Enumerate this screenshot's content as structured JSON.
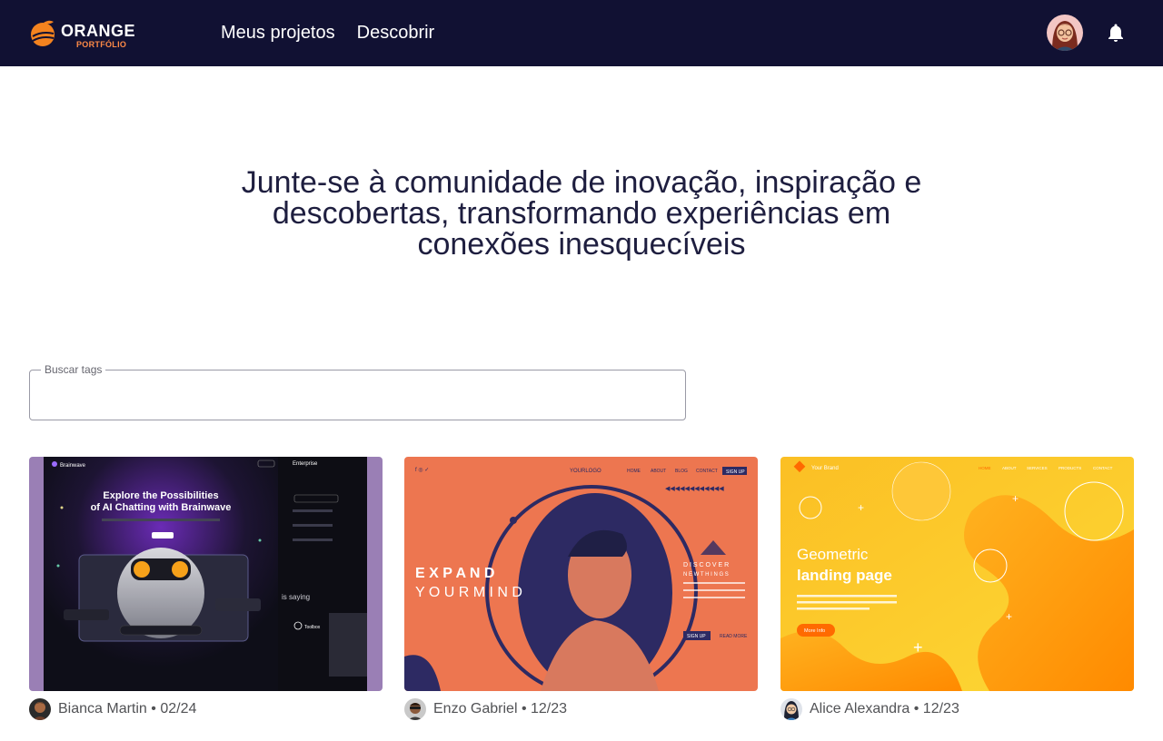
{
  "header": {
    "logo": {
      "brand": "ORANGE",
      "sub": "PORTFÓLIO",
      "icon": "orange-logo-icon"
    },
    "nav": [
      {
        "label": "Meus projetos"
      },
      {
        "label": "Descobrir"
      }
    ],
    "icons": {
      "avatar": "user-avatar",
      "notifications": "bell-icon"
    }
  },
  "hero": {
    "text": "Junte-se à comunidade de inovação, inspiração e descobertas, transformando experiências em conexões inesquecíveis"
  },
  "search": {
    "label": "Buscar tags",
    "value": ""
  },
  "projects": [
    {
      "author": "Bianca Martin",
      "date": "02/24",
      "thumb": {
        "brand": "Brainwave",
        "headline_1": "Explore the Possibilities",
        "headline_2": "of AI Chatting with Brainwave",
        "side_title": "Enterprise",
        "side_note": "is saying",
        "side_name": "Toolbox"
      }
    },
    {
      "author": "Enzo Gabriel",
      "date": "12/23",
      "thumb": {
        "logo": "YOURLOGO",
        "nav": [
          "HOME",
          "ABOUT",
          "BLOG",
          "CONTACT",
          "SIGN UP"
        ],
        "headline_1": "E X P A N D",
        "headline_2": "Y O U R  M I N D",
        "discover": "D I S C O V E R",
        "discover_sub": "N E W  T H I N G S",
        "button": "SIGN UP",
        "link": "READ MORE"
      }
    },
    {
      "author": "Alice Alexandra",
      "date": "12/23",
      "thumb": {
        "brand": "Your Brand",
        "nav": [
          "HOME",
          "ABOUT",
          "SERVICES",
          "PRODUCTS",
          "CONTACT"
        ],
        "headline_1": "Geometric",
        "headline_2": "landing page",
        "button": "More Info"
      }
    }
  ],
  "colors": {
    "header_bg": "#111133",
    "accent": "#fe8a47",
    "hero_text": "#1e1e3f",
    "meta_text": "#515255"
  }
}
